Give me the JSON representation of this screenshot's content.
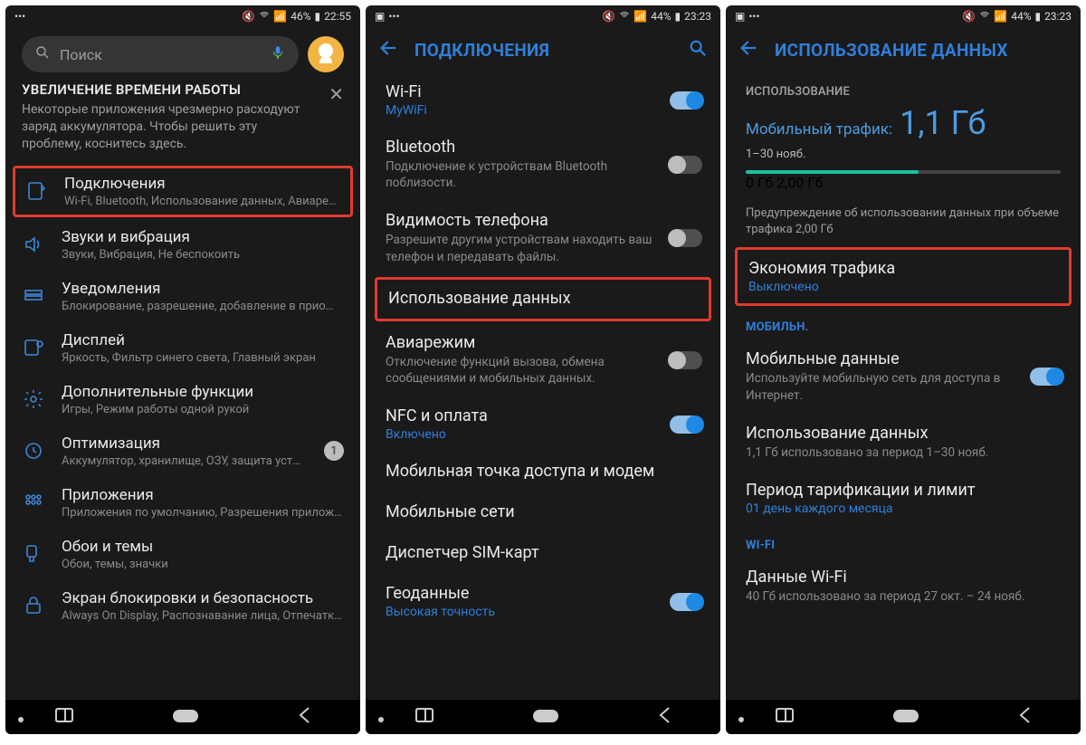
{
  "status": {
    "s1": {
      "battery": "46%",
      "time": "22:55"
    },
    "s2": {
      "battery": "44%",
      "time": "23:23"
    },
    "s3": {
      "battery": "44%",
      "time": "23:23"
    }
  },
  "screen1": {
    "search_placeholder": "Поиск",
    "notice_title": "УВЕЛИЧЕНИЕ ВРЕМЕНИ РАБОТЫ",
    "notice_body": "Некоторые приложения чрезмерно расходуют заряд аккумулятора. Чтобы решить эту проблему, коснитесь здесь.",
    "items": [
      {
        "title": "Подключения",
        "sub": "Wi-Fi, Bluetooth, Использование данных, Авиареж…"
      },
      {
        "title": "Звуки и вибрация",
        "sub": "Звуки, Вибрация, Не беспокоить"
      },
      {
        "title": "Уведомления",
        "sub": "Блокирование, разрешение, добавление в прио…"
      },
      {
        "title": "Дисплей",
        "sub": "Яркость, Фильтр синего света, Главный экран"
      },
      {
        "title": "Дополнительные функции",
        "sub": "Игры, Режим работы одной рукой"
      },
      {
        "title": "Оптимизация",
        "sub": "Аккумулятор, хранилище, ОЗУ, защита уст…",
        "badge": "1"
      },
      {
        "title": "Приложения",
        "sub": "Приложения по умолчанию, Разрешения прилож…"
      },
      {
        "title": "Обои и темы",
        "sub": "Обои, темы, значки"
      },
      {
        "title": "Экран блокировки и безопасность",
        "sub": "Always On Display, Распознавание лица, Отпечатк…"
      }
    ]
  },
  "screen2": {
    "header": "ПОДКЛЮЧЕНИЯ",
    "rows": {
      "wifi": {
        "title": "Wi-Fi",
        "sub": "MyWiFi"
      },
      "bt": {
        "title": "Bluetooth",
        "sub": "Подключение к устройствам Bluetooth поблизости."
      },
      "vis": {
        "title": "Видимость телефона",
        "sub": "Разрешите другим устройствам находить ваш телефон и передавать файлы."
      },
      "data": {
        "title": "Использование данных"
      },
      "air": {
        "title": "Авиарежим",
        "sub": "Отключение функций вызова, обмена сообщениями и мобильных данных."
      },
      "nfc": {
        "title": "NFC и оплата",
        "sub": "Включено"
      },
      "hotspot": {
        "title": "Мобильная точка доступа и модем"
      },
      "mobile": {
        "title": "Мобильные сети"
      },
      "sim": {
        "title": "Диспетчер SIM-карт"
      },
      "geo": {
        "title": "Геоданные",
        "sub": "Высокая точность"
      }
    }
  },
  "screen3": {
    "header": "ИСПОЛЬЗОВАНИЕ ДАННЫХ",
    "sect_usage": "ИСПОЛЬЗОВАНИЕ",
    "traffic_label": "Мобильный трафик:",
    "traffic_value": "1,1 Гб",
    "period": "1–30 нояб.",
    "bar_min": "0 Гб",
    "bar_max": "2,00 Гб",
    "warning": "Предупреждение об использовании данных при объеме трафика 2,00 Гб",
    "saver": {
      "title": "Экономия трафика",
      "sub": "Выключено"
    },
    "sect_mobile": "МОБИЛЬН.",
    "mob_data": {
      "title": "Мобильные данные",
      "sub": "Используйте мобильную сеть для доступа в Интернет."
    },
    "mob_usage": {
      "title": "Использование данных",
      "sub": "1,1 Гб использовано за период 1–30 нояб."
    },
    "billing": {
      "title": "Период тарификации и лимит",
      "sub": "01 день каждого месяца"
    },
    "sect_wifi": "WI-FI",
    "wifi_data": {
      "title": "Данные Wi-Fi",
      "sub": "40 Гб использовано за период 27 окт. – 24 нояб."
    }
  }
}
